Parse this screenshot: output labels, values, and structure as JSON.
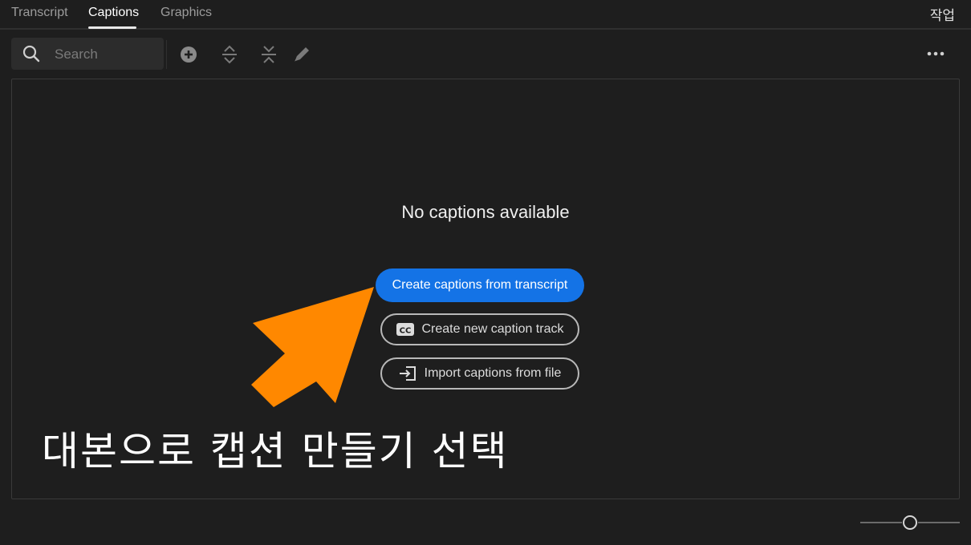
{
  "tabs": [
    {
      "label": "Transcript",
      "active": false
    },
    {
      "label": "Captions",
      "active": true
    },
    {
      "label": "Graphics",
      "active": false
    }
  ],
  "workspace_label": "작업",
  "toolbar": {
    "search_placeholder": "Search",
    "icons": [
      "search-icon",
      "add-icon",
      "expand-icon",
      "collapse-icon",
      "edit-icon",
      "more-icon"
    ]
  },
  "panel": {
    "empty_title": "No captions available",
    "primary_button": "Create captions from transcript",
    "secondary_buttons": [
      {
        "label": "Create new caption track",
        "icon": "cc-icon"
      },
      {
        "label": "Import captions from file",
        "icon": "import-icon"
      }
    ]
  },
  "annotation": {
    "text": "대본으로 캡션 만들기 선택",
    "arrow_color": "#ff8800"
  },
  "colors": {
    "accent": "#1473e6",
    "background": "#1e1e1e"
  }
}
